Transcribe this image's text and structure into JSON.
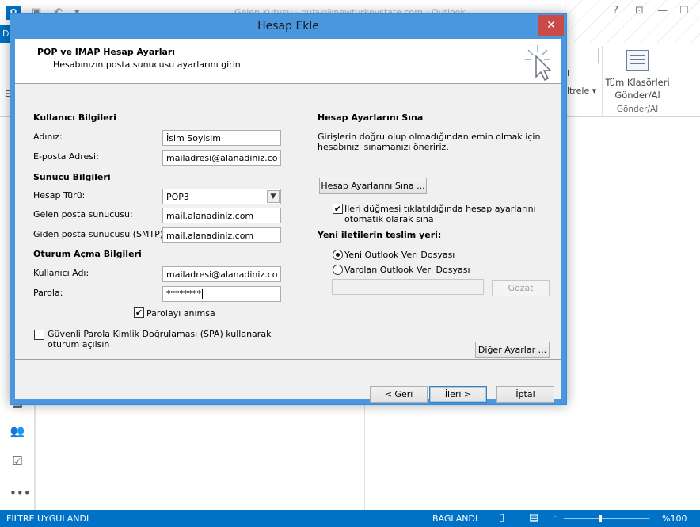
{
  "outlook": {
    "window_title": "Gelen Kutusu - bulak@newturkeystate.com - Outlook",
    "app_logo": "O",
    "file_tab": "D",
    "ribbon_fragment_1": "i",
    "ribbon_fragment_2": "ltrele",
    "ribbon_fragment_3": "E-",
    "send_receive_all_label": "Tüm Klasörleri Gönder/Al",
    "send_receive_group": "Gönder/Al",
    "status_filter": "FİLTRE UYGULANDI",
    "status_connection": "BAĞLANDI",
    "zoom": "%100",
    "accent_color": "#0072c6"
  },
  "dialog": {
    "title": "Hesap Ekle",
    "close_glyph": "✕",
    "header_title": "POP ve IMAP Hesap Ayarları",
    "header_subtitle": "Hesabınızın posta sunucusu ayarlarını girin.",
    "user_info": {
      "section": "Kullanıcı Bilgileri",
      "name_label": "Adınız:",
      "name_value": "İsim Soyisim",
      "email_label": "E-posta Adresi:",
      "email_value": "mailadresi@alanadiniz.com"
    },
    "server_info": {
      "section": "Sunucu Bilgileri",
      "account_type_label": "Hesap Türü:",
      "account_type_value": "POP3",
      "incoming_label": "Gelen posta sunucusu:",
      "incoming_value": "mail.alanadiniz.com",
      "outgoing_label": "Giden posta sunucusu (SMTP):",
      "outgoing_value": "mail.alanadiniz.com"
    },
    "logon_info": {
      "section": "Oturum Açma Bilgileri",
      "username_label": "Kullanıcı Adı:",
      "username_value": "mailadresi@alanadiniz.com",
      "password_label": "Parola:",
      "password_value": "********",
      "remember_label": "Parolayı anımsa",
      "remember_checked": true,
      "spa_label_line1": "Güvenli Parola Kimlik Doğrulaması (SPA) kullanarak",
      "spa_label_line2": "oturum açılsın",
      "spa_checked": false
    },
    "test": {
      "section": "Hesap Ayarlarını Sına",
      "description_line1": "Girişlerin doğru olup olmadığından emin olmak için",
      "description_line2": "hesabınızı sınamanızı öneririz.",
      "test_button": "Hesap Ayarlarını Sına ...",
      "auto_test_line1": "İleri düğmesi tıklatıldığında hesap ayarlarını",
      "auto_test_line2": "otomatik olarak sına",
      "auto_test_checked": true
    },
    "delivery": {
      "section": "Yeni iletilerin teslim yeri:",
      "option_new": "Yeni Outlook Veri Dosyası",
      "option_existing": "Varolan Outlook Veri Dosyası",
      "selected": "new",
      "path_value": "",
      "browse_button": "Gözat"
    },
    "more_settings_button": "Diğer Ayarlar ...",
    "back_button": "< Geri",
    "next_button": "İleri >",
    "cancel_button": "İptal",
    "check_glyph": "✔",
    "dropdown_glyph": "▼"
  }
}
